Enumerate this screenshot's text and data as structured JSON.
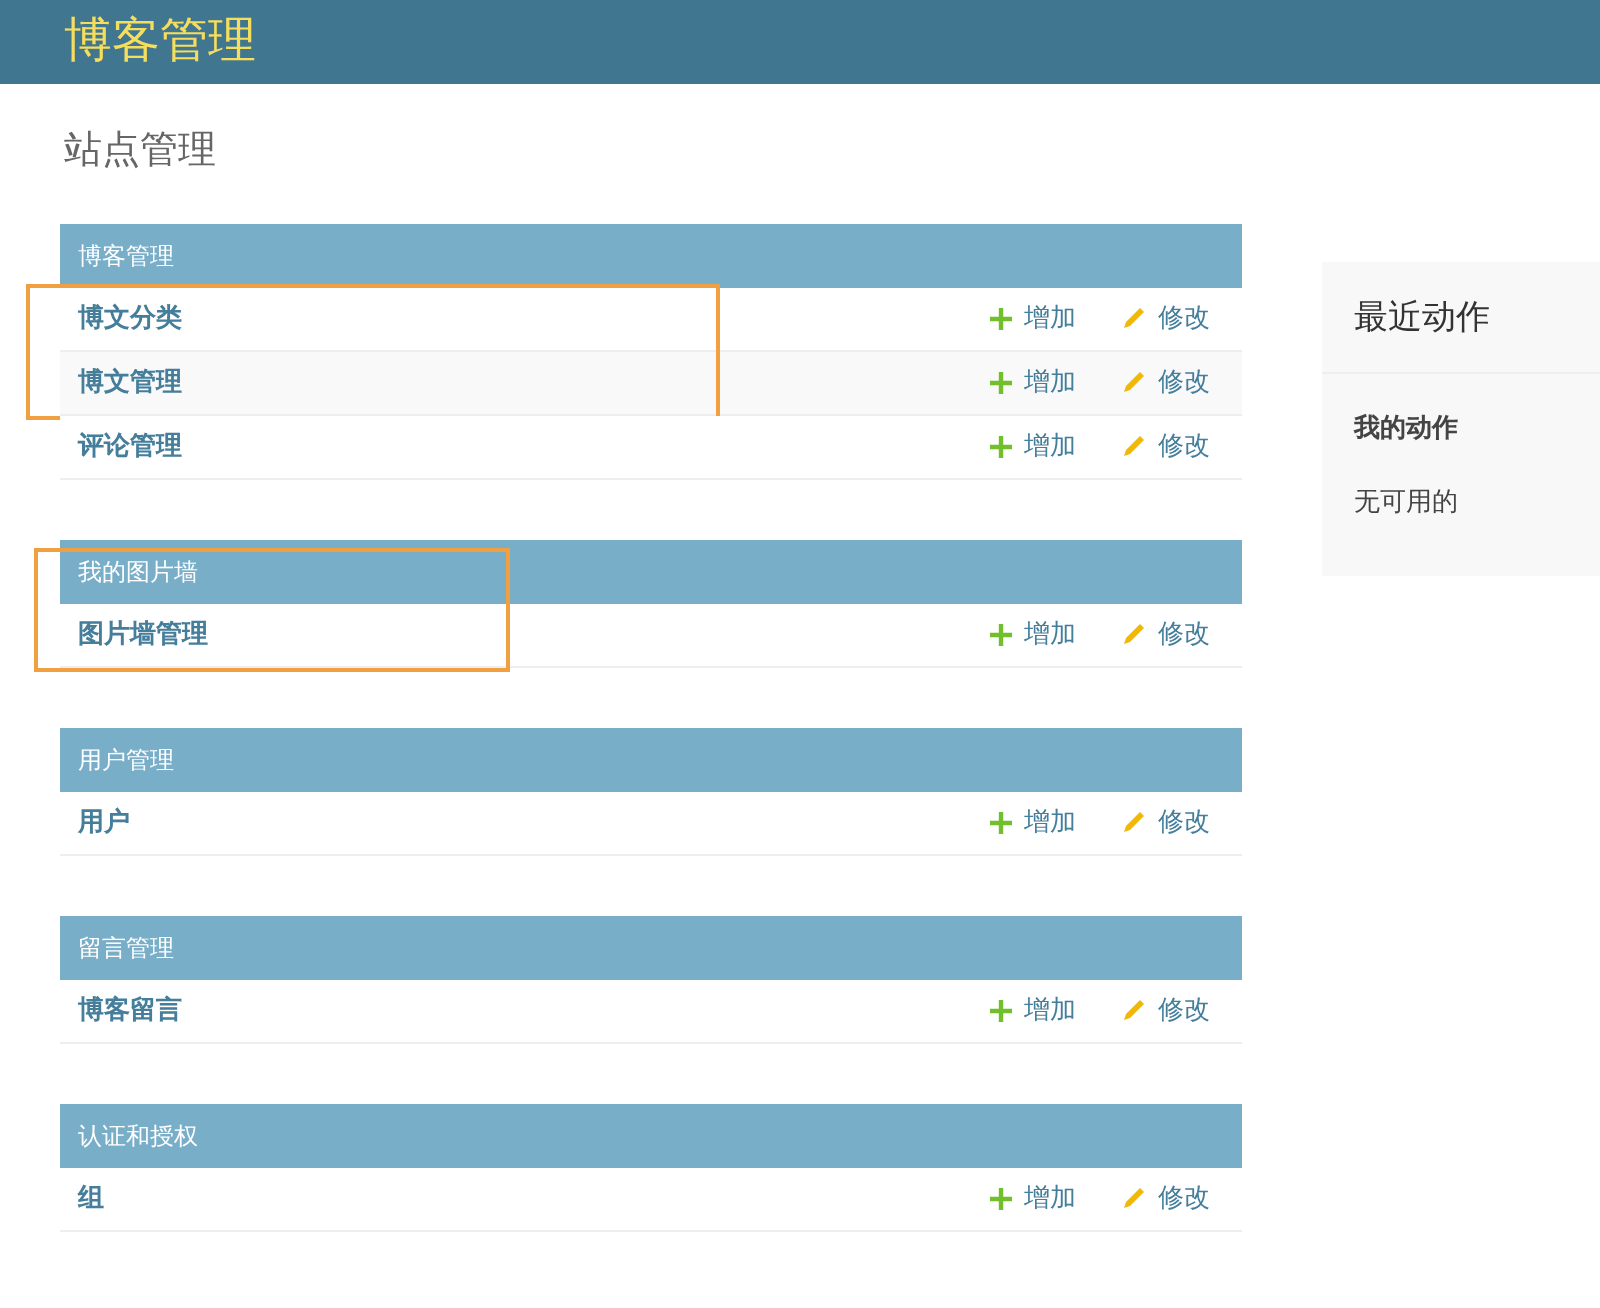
{
  "header": {
    "title": "博客管理"
  },
  "page_title": "站点管理",
  "modules": [
    {
      "caption": "博客管理",
      "caption_highlighted": false,
      "rows": [
        {
          "name": "博文分类",
          "add": "增加",
          "change": "修改",
          "highlighted": true
        },
        {
          "name": "博文管理",
          "add": "增加",
          "change": "修改",
          "highlighted": true
        },
        {
          "name": "评论管理",
          "add": "增加",
          "change": "修改",
          "highlighted": false
        }
      ]
    },
    {
      "caption": "我的图片墙",
      "caption_highlighted": true,
      "rows": [
        {
          "name": "图片墙管理",
          "add": "增加",
          "change": "修改",
          "highlighted": true
        }
      ]
    },
    {
      "caption": "用户管理",
      "caption_highlighted": false,
      "rows": [
        {
          "name": "用户",
          "add": "增加",
          "change": "修改",
          "highlighted": false
        }
      ]
    },
    {
      "caption": "留言管理",
      "caption_highlighted": false,
      "rows": [
        {
          "name": "博客留言",
          "add": "增加",
          "change": "修改",
          "highlighted": false
        }
      ]
    },
    {
      "caption": "认证和授权",
      "caption_highlighted": false,
      "rows": [
        {
          "name": "组",
          "add": "增加",
          "change": "修改",
          "highlighted": false
        }
      ]
    }
  ],
  "recent_actions": {
    "title": "最近动作",
    "subtitle": "我的动作",
    "empty": "无可用的"
  }
}
